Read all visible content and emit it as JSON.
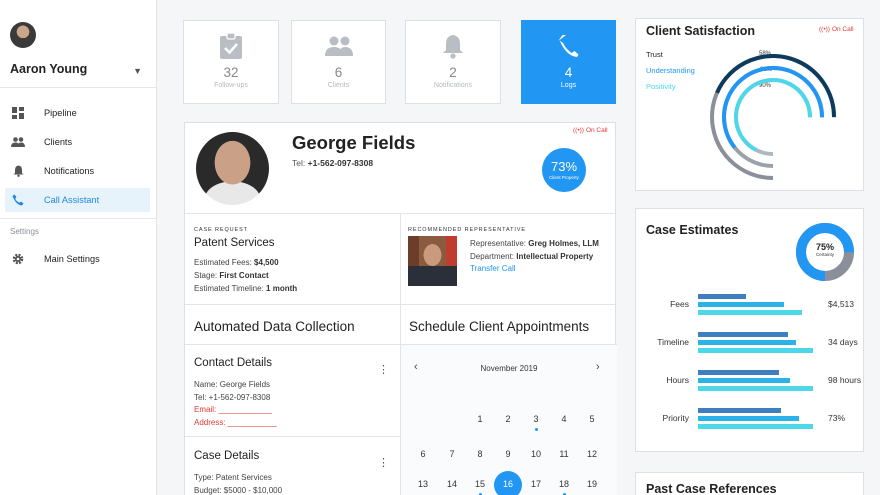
{
  "user": {
    "name": "Aaron Young"
  },
  "nav": {
    "items": [
      {
        "label": "Pipeline",
        "icon": "dashboard-icon"
      },
      {
        "label": "Clients",
        "icon": "people-icon"
      },
      {
        "label": "Notifications",
        "icon": "bell-icon"
      },
      {
        "label": "Call Assistant",
        "icon": "phone-icon"
      }
    ],
    "settings_header": "Settings",
    "settings_items": [
      {
        "label": "Main Settings",
        "icon": "gear-icon"
      }
    ]
  },
  "tiles": [
    {
      "value": "32",
      "label": "Follow-ups",
      "icon": "clipboard-check-icon"
    },
    {
      "value": "6",
      "label": "Clients",
      "icon": "people-icon"
    },
    {
      "value": "2",
      "label": "Notifications",
      "icon": "bell-icon"
    },
    {
      "value": "4",
      "label": "Logs",
      "icon": "phone-icon"
    }
  ],
  "client": {
    "name": "George Fields",
    "tel_label": "Tel:",
    "tel": "+1-562-097-8308",
    "status": "On Call",
    "property_pct": "73%",
    "property_label": "Client Property"
  },
  "case_request": {
    "header": "CASE REQUEST",
    "title": "Patent Services",
    "fees_label": "Estimated Fees:",
    "fees": "$4,500",
    "stage_label": "Stage:",
    "stage": "First Contact",
    "timeline_label": "Estimated Timeline:",
    "timeline": "1 month"
  },
  "representative": {
    "header": "RECOMMENDED REPRESENTATIVE",
    "rep_label": "Representative:",
    "rep": "Greg Holmes, LLM",
    "dept_label": "Department:",
    "dept": "Intellectual Property",
    "transfer": "Transfer Call"
  },
  "adc": {
    "title": "Automated Data Collection",
    "contact": {
      "title": "Contact Details",
      "name": "Name: George Fields",
      "tel": "Tel: +1-562-097-8308",
      "email": "Email: ____________",
      "address": "Address: ___________"
    },
    "case": {
      "title": "Case Details",
      "type": "Type:  Patent Services",
      "budget": "Budget: $5000 - $10,000"
    }
  },
  "schedule": {
    "title": "Schedule Client Appointments",
    "month": "November  2019",
    "days": [
      "1",
      "2",
      "3",
      "4",
      "5",
      "6",
      "7",
      "8",
      "9",
      "10",
      "11",
      "12",
      "13",
      "14",
      "15",
      "16",
      "17",
      "18",
      "19"
    ],
    "selected": "16"
  },
  "satisfaction": {
    "title": "Client Satisfaction",
    "status": "On Call",
    "items": [
      {
        "label": "Trust",
        "value": "58%",
        "pct": 58,
        "color": "#0d3b5e"
      },
      {
        "label": "Understanding",
        "value": "81%",
        "pct": 81,
        "color": "#2196f3"
      },
      {
        "label": "Positivity",
        "value": "90%",
        "pct": 90,
        "color": "#4dd8ea"
      }
    ]
  },
  "estimates": {
    "title": "Case Estimates",
    "certainty_pct": "75%",
    "certainty_label": "Certainty",
    "certainty_value": 0.75,
    "rows": [
      {
        "label": "Fees",
        "value": "$4,513",
        "bars": [
          0.42,
          0.75,
          0.9
        ]
      },
      {
        "label": "Timeline",
        "value": "34 days",
        "bars": [
          0.78,
          0.85,
          1.0
        ]
      },
      {
        "label": "Hours",
        "value": "98 hours",
        "bars": [
          0.7,
          0.8,
          1.0
        ]
      },
      {
        "label": "Priority",
        "value": "73%",
        "bars": [
          0.72,
          0.88,
          1.0
        ]
      }
    ]
  },
  "past": {
    "title": "Past Case References"
  },
  "colors": {
    "accent": "#2196f3",
    "danger": "#e53935",
    "dark_blue": "#3f7fbf",
    "cyan": "#4dd8ea"
  }
}
